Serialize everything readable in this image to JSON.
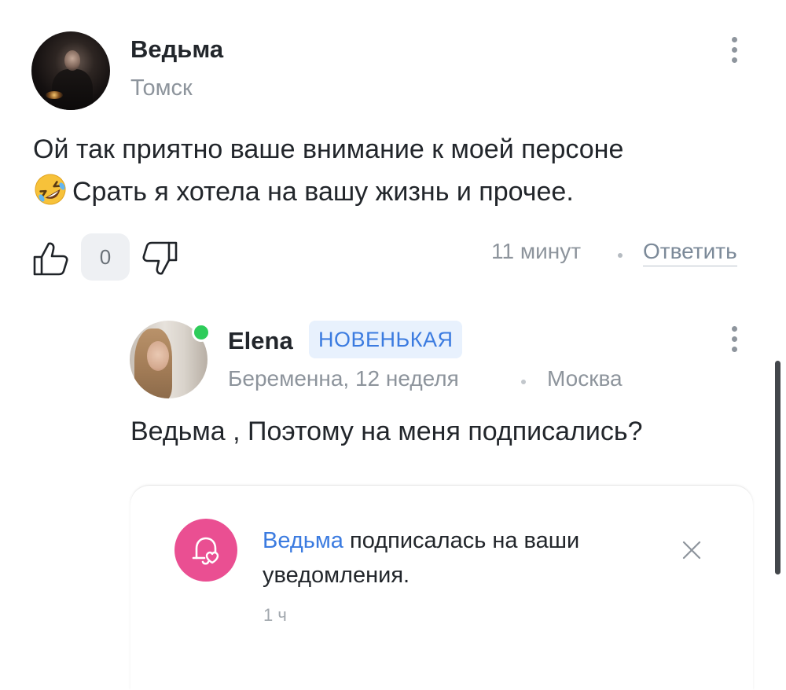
{
  "comment": {
    "author": "Ведьма",
    "location": "Томск",
    "text_line1": "Ой так приятно ваше внимание к моей персоне",
    "text_line2": "Срать я хотела на вашу жизнь и прочее.",
    "emoji": "rolling-on-floor-laughing-emoji",
    "votes": {
      "count": "0"
    },
    "time": "11 минут",
    "reply_label": "Ответить"
  },
  "reply": {
    "author": "Elena",
    "badge": "НОВЕНЬКАЯ",
    "status": "Беременна, 12 неделя",
    "location": "Москва",
    "online": true,
    "text": "Ведьма , Поэтому на меня подписались?"
  },
  "notification": {
    "user": "Ведьма",
    "message": " подписалась на ваши уведомления.",
    "time": "1 ч",
    "icon": "heart-bell-icon",
    "accent": "#ea4f92"
  },
  "colors": {
    "link": "#3b7be0",
    "muted": "#8d949c",
    "online": "#2ecc5a"
  }
}
